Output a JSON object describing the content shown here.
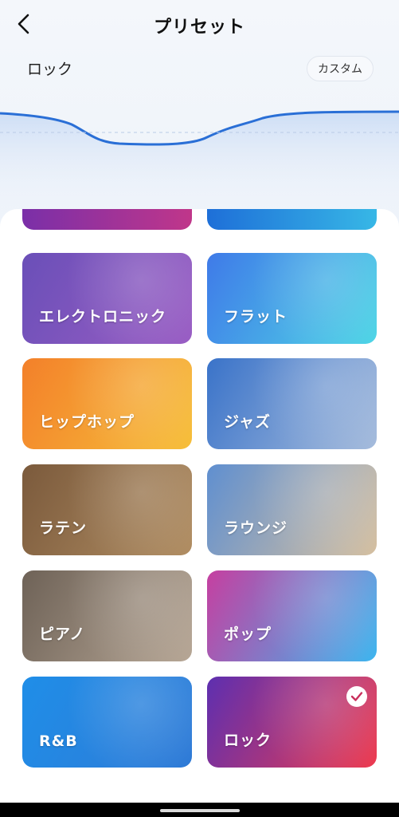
{
  "header": {
    "title": "プリセット",
    "back_icon": "chevron-left-icon"
  },
  "preset": {
    "current": "ロック",
    "custom_label": "カスタム"
  },
  "eq_curve": {
    "color": "#2a6fd6"
  },
  "cards": [
    {
      "label": "エレクトロニック",
      "colors": [
        "#6a4fb8",
        "#9a5ec4"
      ],
      "selected": false
    },
    {
      "label": "フラット",
      "colors": [
        "#3f7ae8",
        "#4fd6e6"
      ],
      "selected": false
    },
    {
      "label": "ヒップホップ",
      "colors": [
        "#f3802a",
        "#f6bf3a"
      ],
      "selected": false
    },
    {
      "label": "ジャズ",
      "colors": [
        "#3a73c9",
        "#a6bcdc"
      ],
      "selected": false
    },
    {
      "label": "ラテン",
      "colors": [
        "#7b5a3c",
        "#b18e63"
      ],
      "selected": false
    },
    {
      "label": "ラウンジ",
      "colors": [
        "#5f8fd0",
        "#d6c0a0"
      ],
      "selected": false
    },
    {
      "label": "ピアノ",
      "colors": [
        "#6e6257",
        "#b7a796"
      ],
      "selected": false
    },
    {
      "label": "ポップ",
      "colors": [
        "#c63fa0",
        "#3db6ef"
      ],
      "selected": false
    },
    {
      "label": "R&B",
      "colors": [
        "#1f8ee8",
        "#2f7ad6"
      ],
      "selected": false
    },
    {
      "label": "ロック",
      "colors": [
        "#5d2fb0",
        "#ee3b4f"
      ],
      "selected": true
    }
  ]
}
